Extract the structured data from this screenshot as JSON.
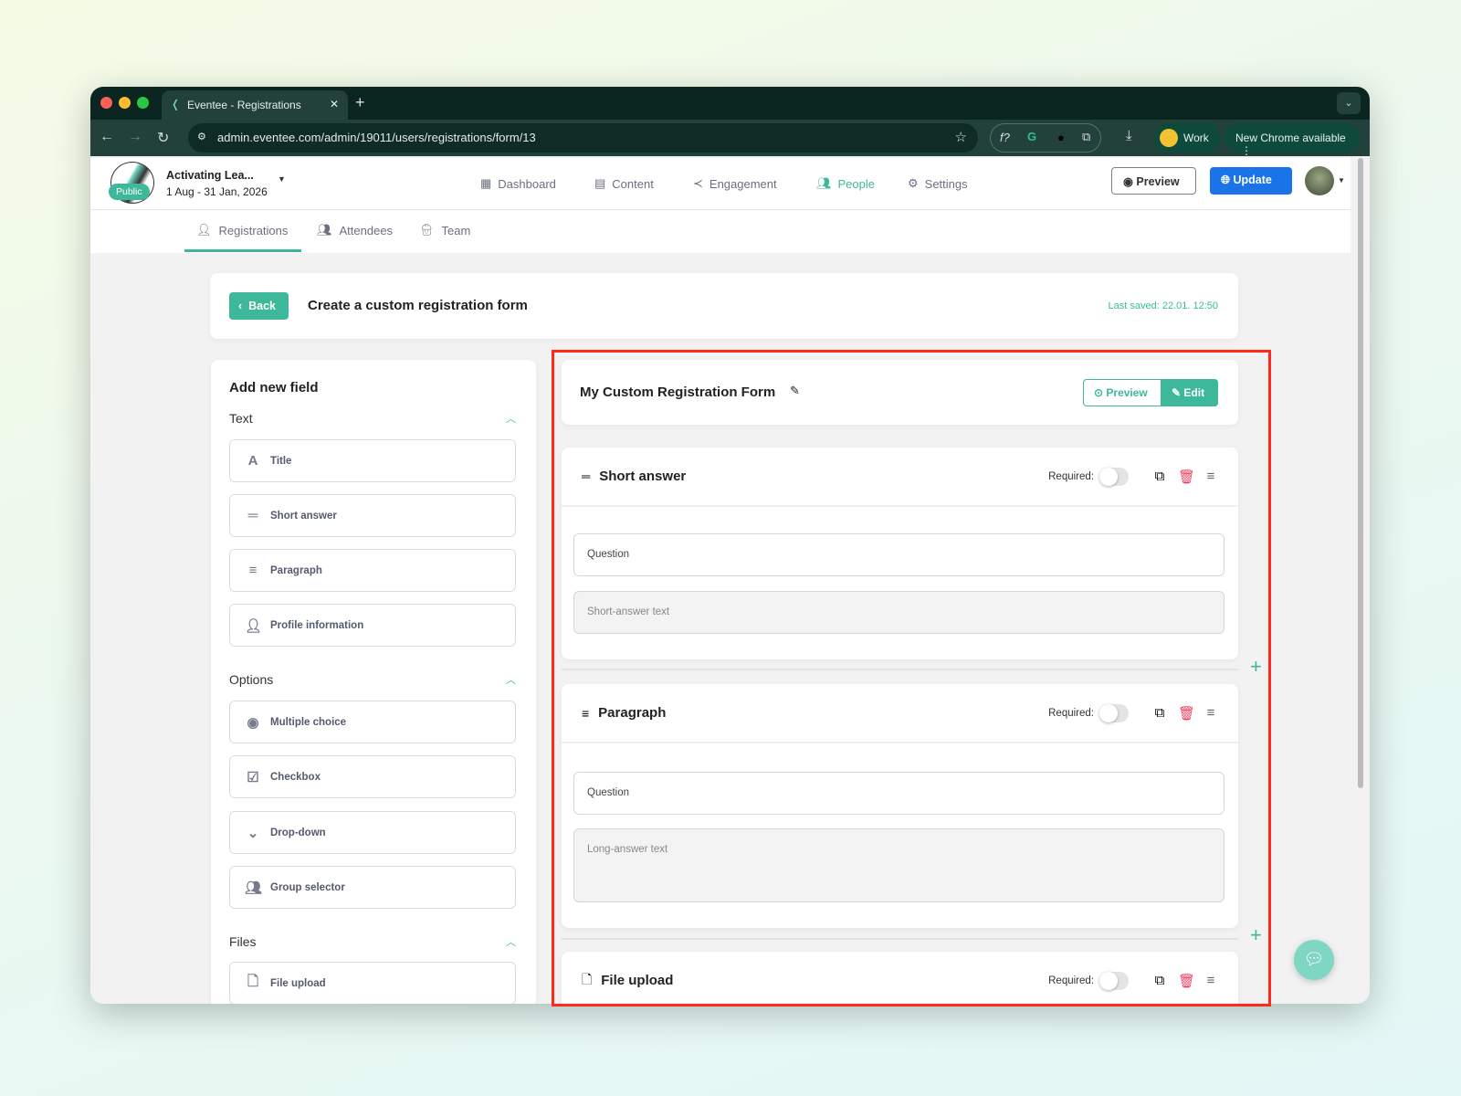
{
  "browser": {
    "tab_title": "Eventee - Registrations",
    "url": "admin.eventee.com/admin/19011/users/registrations/form/13",
    "profile": "Work",
    "update_notice": "New Chrome available"
  },
  "event": {
    "name": "Activating Lea...",
    "dates": "1 Aug - 31 Jan, 2026",
    "badge": "Public"
  },
  "topnav": [
    {
      "label": "Dashboard"
    },
    {
      "label": "Content"
    },
    {
      "label": "Engagement"
    },
    {
      "label": "People"
    },
    {
      "label": "Settings"
    }
  ],
  "header_actions": {
    "preview": "Preview",
    "update": "Update"
  },
  "subnav": [
    {
      "label": "Registrations"
    },
    {
      "label": "Attendees"
    },
    {
      "label": "Team"
    }
  ],
  "page": {
    "back": "Back",
    "title": "Create a custom registration form",
    "last_saved": "Last saved: 22.01. 12:50"
  },
  "sidebar": {
    "heading": "Add new field",
    "sections": [
      {
        "label": "Text",
        "items": [
          {
            "label": "Title"
          },
          {
            "label": "Short answer"
          },
          {
            "label": "Paragraph"
          },
          {
            "label": "Profile information"
          }
        ]
      },
      {
        "label": "Options",
        "items": [
          {
            "label": "Multiple choice"
          },
          {
            "label": "Checkbox"
          },
          {
            "label": "Drop-down"
          },
          {
            "label": "Group selector"
          }
        ]
      },
      {
        "label": "Files",
        "items": [
          {
            "label": "File upload"
          }
        ]
      }
    ]
  },
  "form": {
    "name": "My Custom Registration Form",
    "preview": "Preview",
    "edit": "Edit",
    "required_label": "Required:",
    "fields": [
      {
        "type": "Short answer",
        "question": "Question",
        "placeholder": "Short-answer text",
        "required": false
      },
      {
        "type": "Paragraph",
        "question": "Question",
        "placeholder": "Long-answer text",
        "required": false
      },
      {
        "type": "File upload",
        "required": false
      }
    ]
  },
  "colors": {
    "accent": "#3db89a",
    "primary": "#1a73e8",
    "danger": "#f0395b",
    "highlight": "#ff2a1a"
  }
}
